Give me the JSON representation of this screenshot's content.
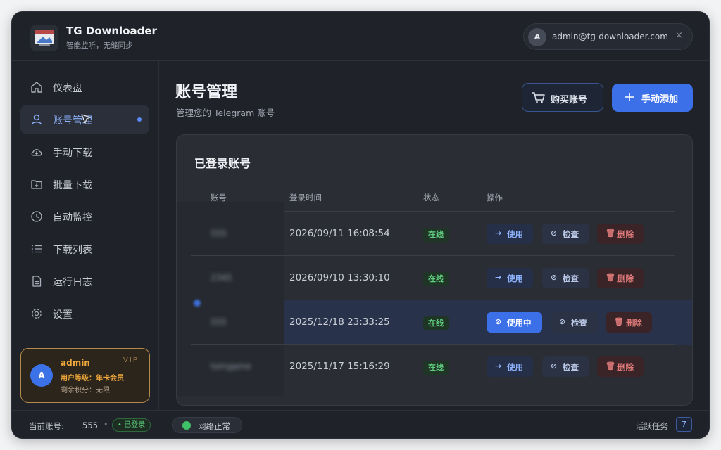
{
  "header": {
    "app_title": "TG Downloader",
    "app_subtitle": "智能监听，无缝同步",
    "user_initial": "A",
    "user_email": "admin@tg-downloader.com",
    "close_glyph": "×"
  },
  "sidebar": {
    "items": [
      {
        "label": "仪表盘",
        "icon": "home-icon"
      },
      {
        "label": "账号管理",
        "icon": "user-icon",
        "active": true
      },
      {
        "label": "手动下载",
        "icon": "cloud-download-icon"
      },
      {
        "label": "批量下载",
        "icon": "folder-download-icon"
      },
      {
        "label": "自动监控",
        "icon": "clock-icon"
      },
      {
        "label": "下载列表",
        "icon": "list-icon"
      },
      {
        "label": "运行日志",
        "icon": "document-icon"
      },
      {
        "label": "设置",
        "icon": "gear-icon"
      }
    ],
    "user_card": {
      "initial": "A",
      "name": "admin",
      "tier": "VIP",
      "level_text": "用户等级：年卡会员",
      "points_text": "剩余积分：无限"
    }
  },
  "main": {
    "title": "账号管理",
    "subtitle": "管理您的 Telegram 账号",
    "buy_label": "购买账号",
    "add_label": "手动添加",
    "card_title": "已登录账号",
    "columns": [
      "账号",
      "登录时间",
      "状态",
      "操作"
    ],
    "rows": [
      {
        "account": "555",
        "login_time": "2026/09/11 16:08:54",
        "status": "在线",
        "primary_action": "使用",
        "check": "检查",
        "delete": "删除"
      },
      {
        "account": "2345",
        "login_time": "2026/09/10 13:30:10",
        "status": "在线",
        "primary_action": "使用",
        "check": "检查",
        "delete": "删除"
      },
      {
        "account": "555",
        "login_time": "2025/12/18 23:33:25",
        "status": "在线",
        "primary_action": "使用中",
        "check": "检查",
        "delete": "删除",
        "current": true
      },
      {
        "account": "tomgame",
        "login_time": "2025/11/17 15:16:29",
        "status": "在线",
        "primary_action": "使用",
        "check": "检查",
        "delete": "删除"
      }
    ]
  },
  "footer": {
    "current_account_label": "当前账号:",
    "current_account": "555",
    "separator": "•",
    "login_badge": "• 已登录",
    "network_status": "网络正常",
    "active_tasks_label": "活跃任务",
    "active_tasks": "7"
  },
  "colors": {
    "accent": "#3c70e8",
    "background": "#1f2229",
    "card": "#2a2d34",
    "online_green": "#62d182",
    "vip_gold": "#f0a93a",
    "danger": "#e07a7a"
  }
}
